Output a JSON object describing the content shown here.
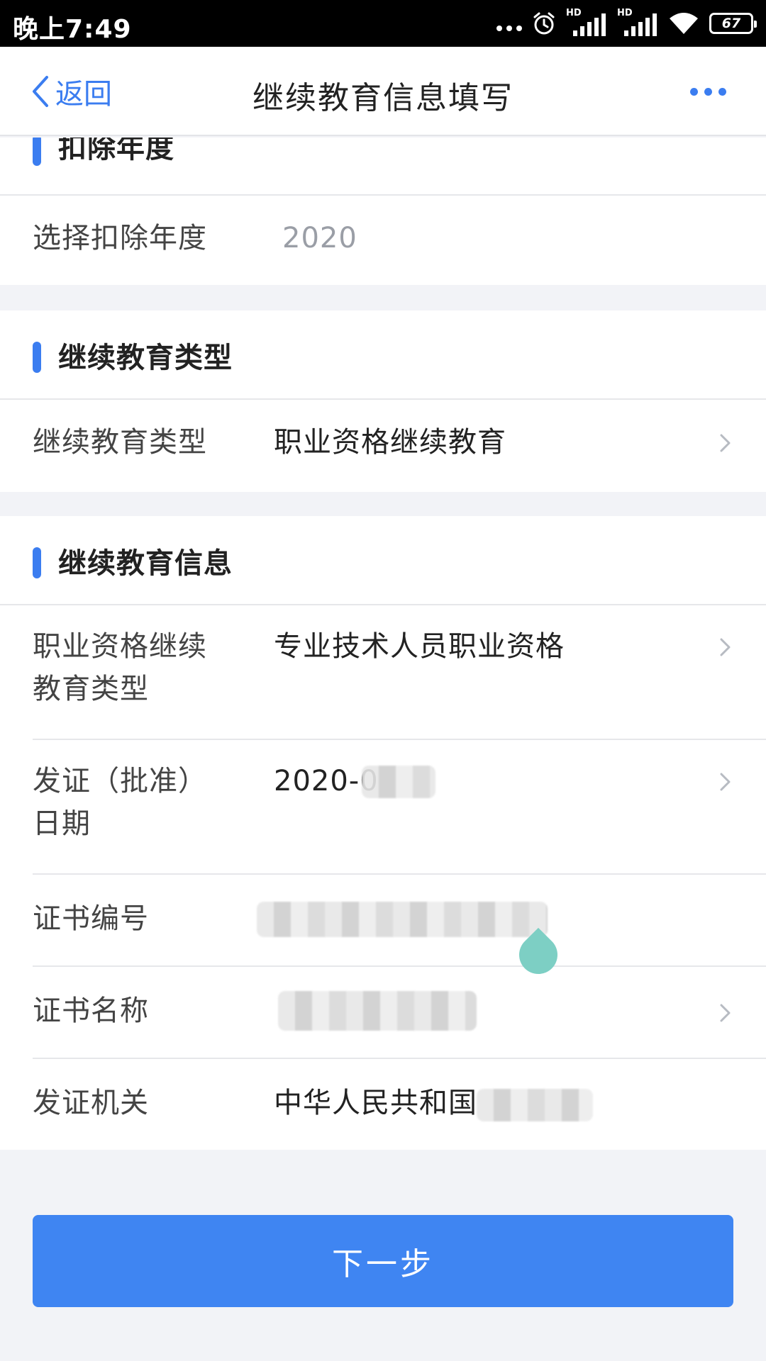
{
  "status_bar": {
    "time": "晚上7:49",
    "network_label_1": "HD",
    "network_label_2": "HD",
    "battery": "67"
  },
  "nav": {
    "back_label": "返回",
    "title": "继续教育信息填写"
  },
  "sections": {
    "deduction_year": {
      "header": "扣除年度",
      "row_label": "选择扣除年度",
      "row_value": "2020"
    },
    "education_type": {
      "header": "继续教育类型",
      "row_label": "继续教育类型",
      "row_value": "职业资格继续教育"
    },
    "education_info": {
      "header": "继续教育信息",
      "rows": [
        {
          "label_line1": "职业资格继续",
          "label_line2": "教育类型",
          "value": "专业技术人员职业资格"
        },
        {
          "label_line1": "发证（批准）",
          "label_line2": "日期",
          "value": "2020-0"
        },
        {
          "label": "证书编号",
          "value": ""
        },
        {
          "label": "证书名称",
          "value": ""
        },
        {
          "label": "发证机关",
          "value": "中华人民共和国"
        }
      ]
    }
  },
  "next_button": "下一步",
  "colors": {
    "accent": "#3b7df0",
    "button": "#3f85f2",
    "page_bg": "#f2f3f7"
  }
}
